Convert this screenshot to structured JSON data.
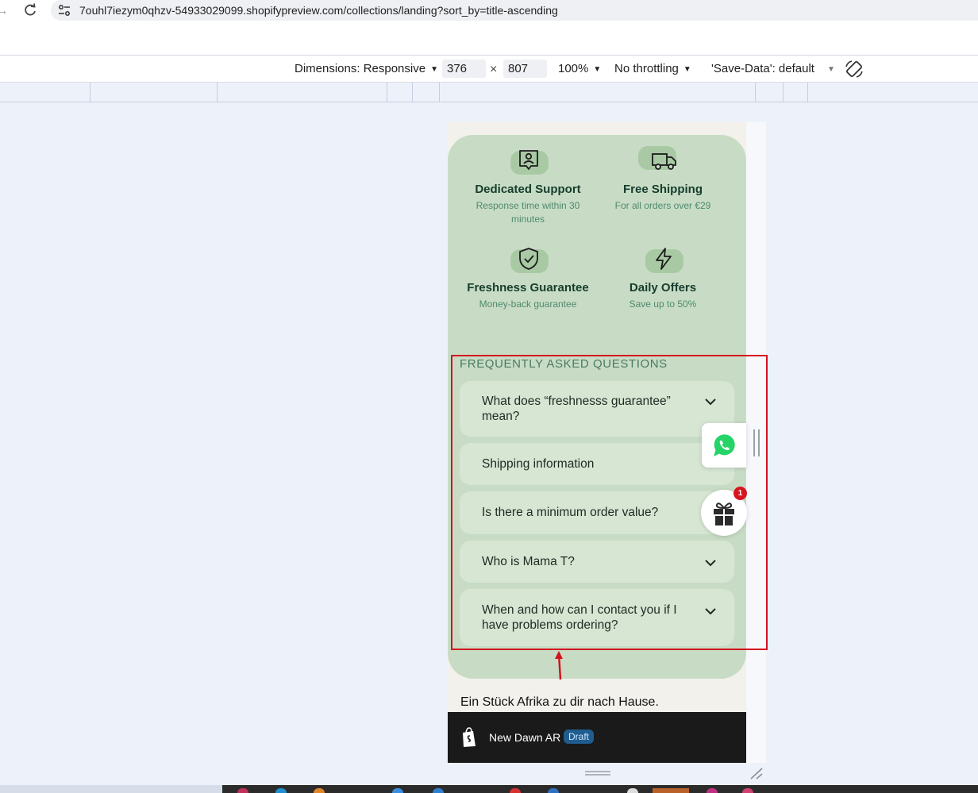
{
  "browser": {
    "url": "7ouhl7iezym0qhzv-54933029099.shopifypreview.com/collections/landing?sort_by=title-ascending"
  },
  "device_toolbar": {
    "dimensions_label": "Dimensions: Responsive",
    "width_value": "376",
    "times_sign": "×",
    "height_value": "807",
    "zoom_label": "100%",
    "throttling_label": "No throttling",
    "save_data_label": "'Save-Data': default"
  },
  "features": [
    {
      "icon": "support-icon",
      "title": "Dedicated Support",
      "subtitle": "Response time within 30 minutes"
    },
    {
      "icon": "truck-icon",
      "title": "Free Shipping",
      "subtitle": "For all orders over €29"
    },
    {
      "icon": "shield-check-icon",
      "title": "Freshness Guarantee",
      "subtitle": "Money-back guarantee"
    },
    {
      "icon": "lightning-icon",
      "title": "Daily Offers",
      "subtitle": "Save up to 50%"
    }
  ],
  "faq": {
    "heading": "FREQUENTLY ASKED QUESTIONS",
    "items": [
      {
        "question": "What does “freshnesss guarantee” mean?"
      },
      {
        "question": "Shipping information"
      },
      {
        "question": "Is there a minimum order value?"
      },
      {
        "question": "Who is Mama T?"
      },
      {
        "question": "When and how can I contact you if I have problems ordering?"
      }
    ]
  },
  "footer": {
    "tagline": "Ein Stück Afrika zu dir nach Hause."
  },
  "preview_bar": {
    "store_name": "New Dawn AR",
    "badge": "Draft"
  },
  "widgets": {
    "gift_count": "1"
  },
  "colors": {
    "card_green": "#c8dcc5",
    "faq_item": "#d6e6d3",
    "annotation_red": "#d4121e",
    "whatsapp_green": "#25d366"
  }
}
